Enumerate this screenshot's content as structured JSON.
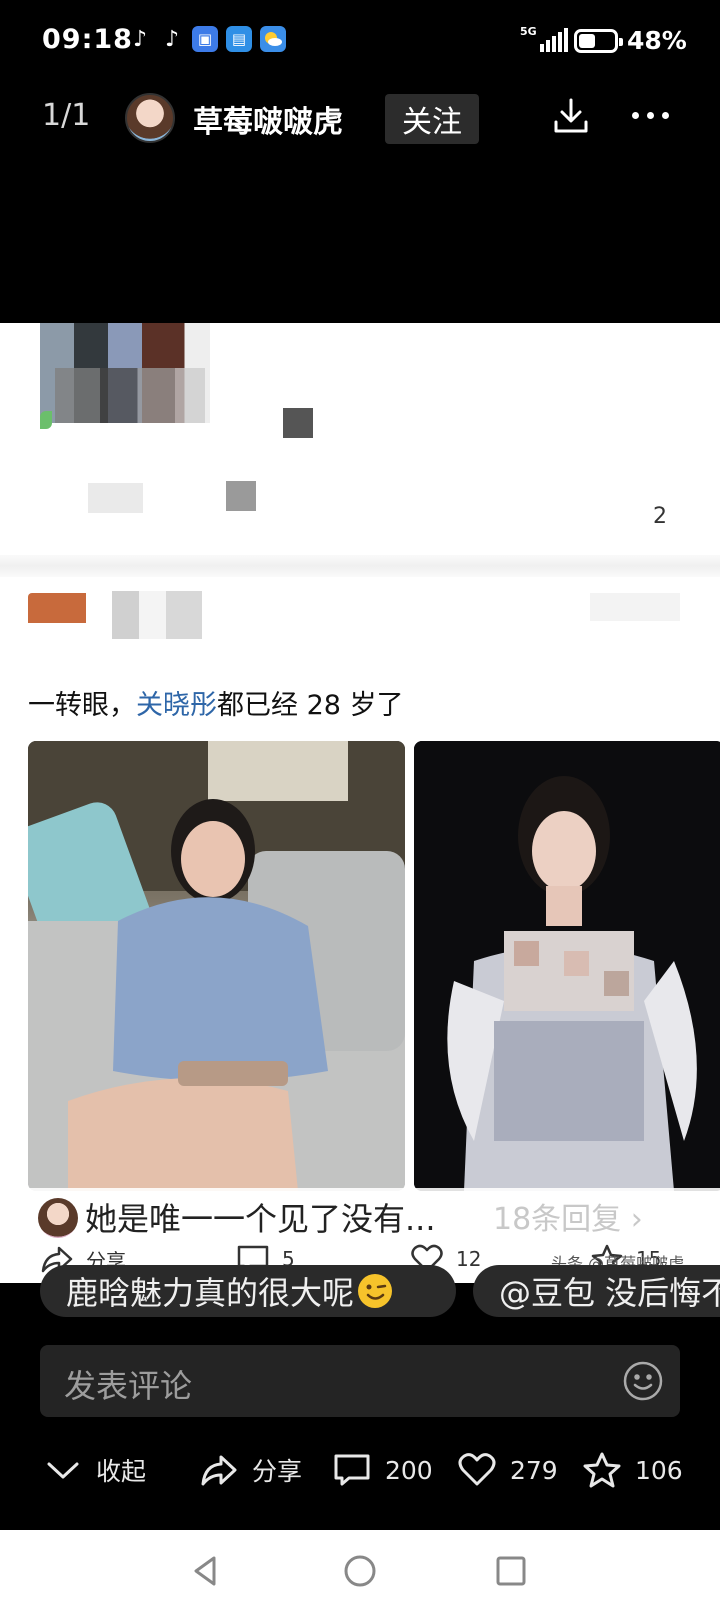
{
  "status_bar": {
    "time": "09:18",
    "network": "5G",
    "battery": "48%",
    "battery_level": 0.48,
    "notification_icons": [
      "tiktok-icon",
      "tiktok-icon",
      "app-icon",
      "book-icon",
      "weather-icon"
    ]
  },
  "header": {
    "page_count": "1/1",
    "author_name": "草莓啵啵虎",
    "follow_label": "关注"
  },
  "card": {
    "post_number": "2",
    "post_text_prefix": "一转眼，",
    "post_text_link": "关晓彤",
    "post_text_suffix": "都已经 28 岁了",
    "reply_text": "她是唯一一个见了没有...",
    "reply_count": "18条回复 ›",
    "share_label": "分享",
    "comment_count": "5",
    "like_count": "12",
    "favorite_count": "15",
    "watermark": "头条 @草莓啵啵虎"
  },
  "chips": [
    {
      "label": "鹿晗魅力真的很大呢"
    },
    {
      "label": "@豆包 没后悔不"
    }
  ],
  "comment_input": {
    "placeholder": "发表评论"
  },
  "actions": {
    "collapse_label": "收起",
    "share_label": "分享",
    "comments": "200",
    "likes": "279",
    "favorites": "106"
  },
  "colors": {
    "background": "#000000",
    "link": "#2e66a8",
    "chip_background": "#2a2a2a",
    "input_background": "#242424"
  }
}
